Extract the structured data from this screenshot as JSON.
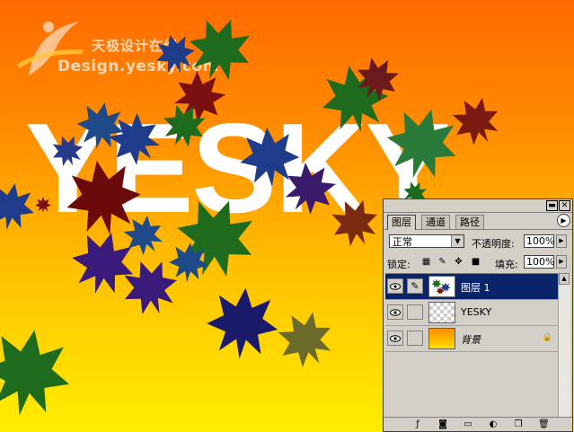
{
  "watermark": {
    "cn_text": "天极设计在线",
    "en_text": "Design.yesky.com"
  },
  "artwork": {
    "text": "YESKY"
  },
  "panel": {
    "tabs": [
      "图层",
      "通道",
      "路径"
    ],
    "active_tab": "图层",
    "blend_mode": "正常",
    "opacity_label": "不透明度:",
    "opacity_value": "100%",
    "lock_label": "锁定:",
    "fill_label": "填充:",
    "fill_value": "100%",
    "layers": [
      {
        "name": "图层 1",
        "selected": true,
        "thumb": "leaves-icon"
      },
      {
        "name": "YESKY",
        "selected": false,
        "thumb": "checker"
      },
      {
        "name": "背景",
        "selected": false,
        "thumb": "gradient",
        "locked": true
      }
    ]
  },
  "colors": {
    "bg_top": "#ff6a00",
    "bg_bottom": "#ffee00",
    "selection": "#0a246a",
    "panel": "#d4d0c8"
  }
}
